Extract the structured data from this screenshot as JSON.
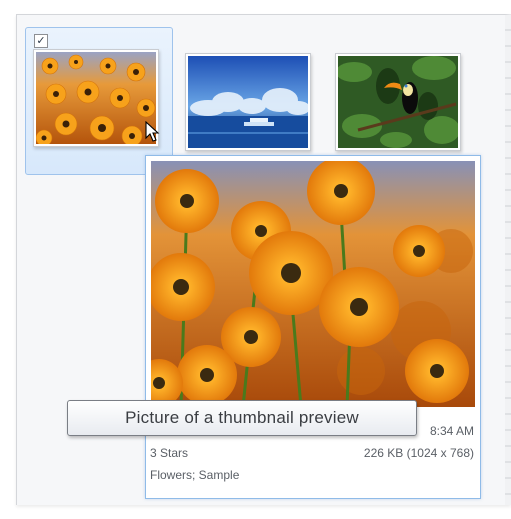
{
  "thumbnails": [
    {
      "name": "flowers-thumbnail",
      "selected": true,
      "checked": true
    },
    {
      "name": "ocean-thumbnail",
      "selected": false
    },
    {
      "name": "toucan-thumbnail",
      "selected": false
    }
  ],
  "checkbox_glyph": "✓",
  "preview": {
    "time_partial": "8:34 AM",
    "rating": "3 Stars",
    "size": "226 KB (1024 x 768)",
    "tags": "Flowers; Sample"
  },
  "tooltip": {
    "text": "Picture of a thumbnail preview"
  },
  "colors": {
    "selection": "#d7e8fb",
    "selection_border": "#9fc3ec",
    "preview_border": "#8fbbe8"
  }
}
